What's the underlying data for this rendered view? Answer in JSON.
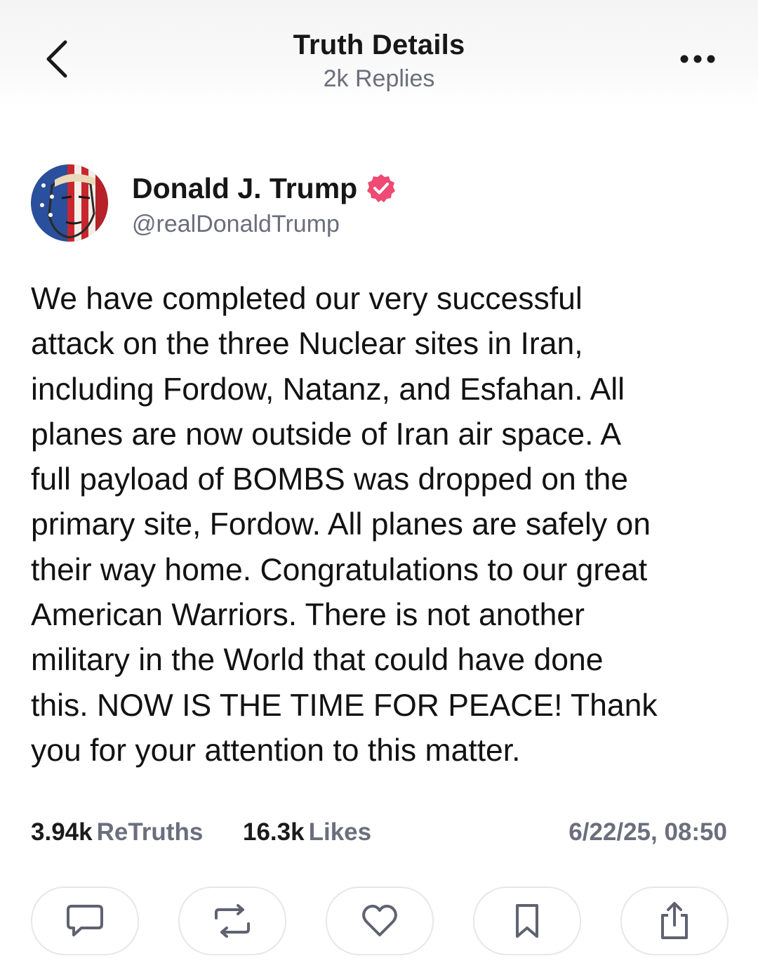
{
  "header": {
    "title": "Truth Details",
    "subtitle": "2k Replies",
    "back_icon": "chevron-left-icon",
    "more_icon": "more-horizontal-icon"
  },
  "author": {
    "name": "Donald J. Trump",
    "handle": "@realDonaldTrump",
    "verified": true,
    "verified_badge_color": "#ee4a74",
    "avatar_icon": "avatar"
  },
  "post": {
    "lines": [
      "We have completed our very successful",
      "attack on the three Nuclear sites in Iran,",
      "including Fordow, Natanz, and Esfahan. All",
      "planes are now outside of Iran air space. A",
      "full payload of BOMBS was dropped on the",
      "primary site, Fordow. All planes are safely on",
      "their way home. Congratulations to our great",
      "American Warriors. There is not another",
      "military in the World that could have done",
      "this. NOW IS THE TIME FOR PEACE! Thank",
      "you for your attention to this matter."
    ]
  },
  "stats": {
    "retruths_count": "3.94k",
    "retruths_label": "ReTruths",
    "likes_count": "16.3k",
    "likes_label": "Likes",
    "timestamp": "6/22/25, 08:50"
  },
  "actions": [
    {
      "name": "reply",
      "icon": "comment-icon"
    },
    {
      "name": "retruth",
      "icon": "repost-icon"
    },
    {
      "name": "like",
      "icon": "heart-icon"
    },
    {
      "name": "bookmark",
      "icon": "bookmark-icon"
    },
    {
      "name": "share",
      "icon": "share-icon"
    }
  ],
  "colors": {
    "muted_text": "#6b6e7c",
    "primary_text": "#121212",
    "button_border": "#e7e7ea",
    "icon_stroke": "#5f6270"
  }
}
